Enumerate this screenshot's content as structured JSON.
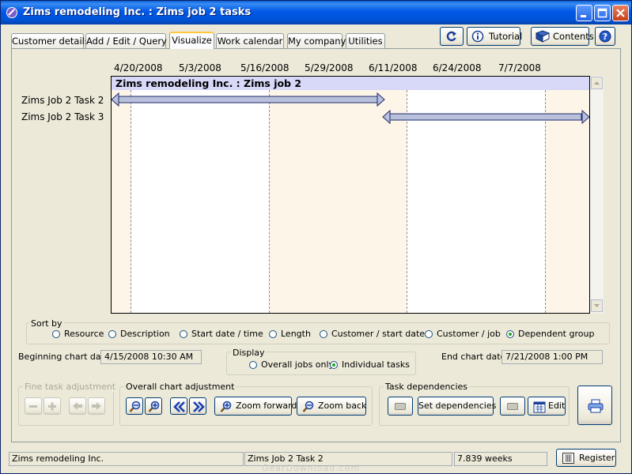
{
  "window": {
    "title": "Zims remodeling Inc. : Zims job 2 tasks"
  },
  "tabs": [
    {
      "label": "Customer details"
    },
    {
      "label": "Add / Edit / Query"
    },
    {
      "label": "Visualize"
    },
    {
      "label": "Work calendar"
    },
    {
      "label": "My company"
    },
    {
      "label": "Utilities"
    }
  ],
  "active_tab": "Visualize",
  "toolbar": {
    "tutorial_label": "Tutorial",
    "contents_label": "Contents"
  },
  "chart": {
    "title": "Zims remodeling Inc. : Zims job 2",
    "date_headers": [
      "4/20/2008",
      "5/3/2008",
      "5/16/2008",
      "5/29/2008",
      "6/11/2008",
      "6/24/2008",
      "7/7/2008"
    ],
    "tasks": [
      {
        "label": "Zims Job 2 Task 2",
        "start": "4/15/2008",
        "end": "6/12/2008"
      },
      {
        "label": "Zims Job 2 Task 3",
        "start": "6/12/2008",
        "end": "7/21/2008"
      }
    ],
    "colors": {
      "title_bg": "#d8d8f8",
      "band_bg": "#fdf5e8",
      "task_bar": "#b9c0dc"
    }
  },
  "sort_by": {
    "label": "Sort by",
    "options": [
      {
        "label": "Resource",
        "selected": false
      },
      {
        "label": "Description",
        "selected": false
      },
      {
        "label": "Start date / time",
        "selected": false
      },
      {
        "label": "Length",
        "selected": false
      },
      {
        "label": "Customer / start date",
        "selected": false
      },
      {
        "label": "Customer / job",
        "selected": false
      },
      {
        "label": "Dependent group",
        "selected": true
      }
    ]
  },
  "beginning_chart_date": {
    "label": "Beginning chart date",
    "value": "4/15/2008 10:30 AM"
  },
  "end_chart_date": {
    "label": "End chart date",
    "value": "7/21/2008 1:00 PM"
  },
  "display": {
    "label": "Display",
    "options": [
      {
        "label": "Overall jobs only",
        "selected": false
      },
      {
        "label": "Individual tasks",
        "selected": true
      }
    ]
  },
  "fine_task_adjustment": {
    "label": "Fine task adjustment"
  },
  "overall_chart_adjustment": {
    "label": "Overall chart adjustment",
    "zoom_forward": "Zoom forward",
    "zoom_back": "Zoom back"
  },
  "task_dependencies": {
    "label": "Task dependencies",
    "set_dependencies": "Set dependencies",
    "edit": "Edit"
  },
  "statusbar": {
    "company": "Zims remodeling Inc.",
    "task": "Zims Job 2 Task 2",
    "duration": "7.839 weeks",
    "register_label": "Register"
  },
  "watermark": "GearDownload.com",
  "icons": [
    "app-icon",
    "minimize-icon",
    "maximize-icon",
    "close-icon",
    "refresh-icon",
    "tutorial-icon",
    "book-icon",
    "help-icon",
    "zoom-in-icon",
    "zoom-out-icon",
    "rewind-icon",
    "fast-forward-icon",
    "calendar-icon",
    "printer-icon"
  ]
}
